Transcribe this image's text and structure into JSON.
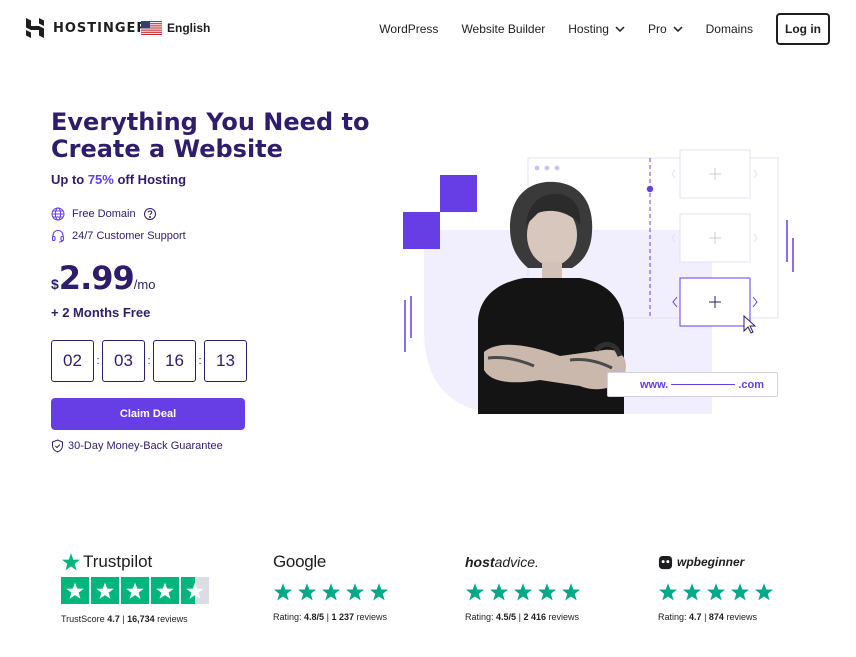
{
  "header": {
    "logo_text": "HOSTINGER",
    "language": "English",
    "nav": [
      {
        "label": "WordPress",
        "dropdown": false
      },
      {
        "label": "Website Builder",
        "dropdown": false
      },
      {
        "label": "Hosting",
        "dropdown": true
      },
      {
        "label": "Pro",
        "dropdown": true
      },
      {
        "label": "Domains",
        "dropdown": false
      }
    ],
    "login_label": "Log in"
  },
  "hero": {
    "title": "Everything You Need to Create a Website",
    "promo_prefix": "Up to ",
    "promo_accent": "75%",
    "promo_suffix": " off Hosting",
    "features": [
      {
        "icon": "globe-icon",
        "label": "Free Domain",
        "has_help": true
      },
      {
        "icon": "headset-icon",
        "label": "24/7 Customer Support",
        "has_help": false
      }
    ],
    "price": {
      "currency": "$",
      "amount": "2.99",
      "period": "/mo"
    },
    "bonus": "+ 2 Months Free",
    "countdown": [
      "02",
      "03",
      "16",
      "13"
    ],
    "cta_label": "Claim Deal",
    "guarantee": "30-Day Money-Back Guarantee",
    "url_prefix": "www.",
    "url_suffix": ".com"
  },
  "reviews": [
    {
      "brand": "Trustpilot",
      "score_label": "TrustScore",
      "score": "4.7",
      "count": "16,734",
      "count_label": "reviews",
      "stars": 4.5
    },
    {
      "brand": "Google",
      "score_label": "Rating:",
      "score": "4.8/5",
      "count": "1 237",
      "count_label": "reviews",
      "stars": 5
    },
    {
      "brand_light": "host",
      "brand_bold": "advice.",
      "score_label": "Rating:",
      "score": "4.5/5",
      "count": "2 416",
      "count_label": "reviews",
      "stars": 5
    },
    {
      "brand": "wpbeginner",
      "score_label": "Rating:",
      "score": "4.7",
      "count": "874",
      "count_label": "reviews",
      "stars": 5
    }
  ],
  "colors": {
    "brand_purple": "#673de6",
    "heading_navy": "#2f1c6a",
    "trustpilot_green": "#00b67a",
    "review_star_teal": "#00a88a"
  }
}
